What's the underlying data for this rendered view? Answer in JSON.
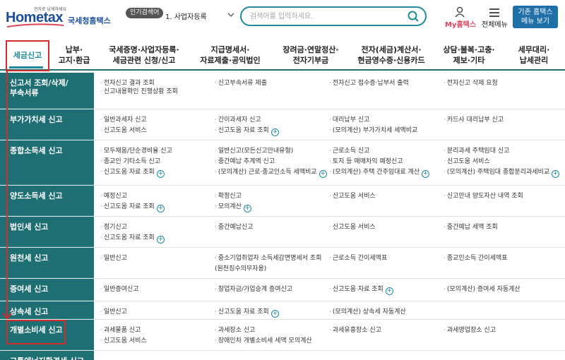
{
  "header": {
    "logo": {
      "tagline": "전자로 납세하세요",
      "brand": "Hometax",
      "org": "국세청홈택스"
    },
    "popular": {
      "badge": "인기검색어",
      "item": "1. 사업자등록"
    },
    "search": {
      "placeholder": "검색어를 입력하세요."
    },
    "my": "My홈택스",
    "menu": "전체메뉴",
    "classic": [
      "기존 홈택스",
      "메뉴 보기"
    ]
  },
  "nav": [
    {
      "lines": [
        "세금신고"
      ],
      "active": true
    },
    {
      "lines": [
        "납부·",
        "고지·환급"
      ]
    },
    {
      "lines": [
        "국세증명·사업자등록·",
        "세금관련 신청/신고"
      ]
    },
    {
      "lines": [
        "지급명세서·",
        "자료제출·공익법인"
      ]
    },
    {
      "lines": [
        "장려금·연말정산·",
        "전자기부금"
      ]
    },
    {
      "lines": [
        "전자(세금)계산서·",
        "현금영수증·신용카드"
      ]
    },
    {
      "lines": [
        "상담·불복·고충·",
        "제보·기타"
      ]
    },
    {
      "lines": [
        "세무대리·",
        "납세관리"
      ]
    }
  ],
  "rows": [
    {
      "head": [
        "신고서 조회/삭제/",
        "부속서류"
      ],
      "items": [
        [
          "전자신고 결과 조회",
          "신고부속서류 제출",
          "전자신고 접수증·납부서 출력",
          "전자신고 삭제 요청"
        ],
        [
          "신고내용확인 진행상황 조회",
          "",
          "",
          ""
        ]
      ]
    },
    {
      "head": [
        "부가가치세 신고"
      ],
      "items": [
        [
          "일반과세자 신고",
          "간이과세자 신고",
          "대리납부 신고",
          "카드사 대리납부 신고"
        ],
        [
          "신고도움 서비스",
          "신고도움 자료 조회",
          "(모의계산) 부가가치세 세액비교",
          ""
        ]
      ]
    },
    {
      "head": [
        "종합소득세 신고"
      ],
      "items": [
        [
          "모두채움/단순경비율 신고",
          "일반신고(모든신고안내유형)",
          "근로소득 신고",
          "분리과세 주택임대 신고"
        ],
        [
          "종교인 기타소득 신고",
          "중간예납 추계액 신고",
          "토지 등 매매차익 예정신고",
          "신고도움 서비스"
        ],
        [
          "신고도움 자료 조회",
          "(모의계산) 근로·종교인소득 세액비교",
          "(모의계산) 주택 간주임대료 계산",
          "(모의계산) 주택임대 종합분리과세비교"
        ]
      ]
    },
    {
      "head": [
        "양도소득세 신고"
      ],
      "items": [
        [
          "예정신고",
          "확정신고",
          "신고도움 서비스",
          "신고안내 양도자산 내역 조회"
        ],
        [
          "신고도움 자료 조회",
          "모의계산",
          "",
          ""
        ]
      ]
    },
    {
      "head": [
        "법인세 신고"
      ],
      "items": [
        [
          "정기신고",
          "중간예납신고",
          "신고도움 서비스",
          "중간예납 세액 조회"
        ],
        [
          "신고도움 자료 조회",
          "",
          "",
          ""
        ]
      ]
    },
    {
      "head": [
        "원천세 신고"
      ],
      "items": [
        [
          "일반신고",
          "중소기업취업자 소득세감면명세서 조회",
          "근로소득 간이세액표",
          "종교인소득 간이세액표"
        ],
        [
          "",
          "(원천징수의무자용)",
          "",
          ""
        ]
      ]
    },
    {
      "head": [
        "증여세 신고"
      ],
      "items": [
        [
          "일반증여신고",
          "창업자금/가업승계 증여신고",
          "신고도움 자료 조회",
          "(모의계산) 증여세 자동계산"
        ]
      ]
    },
    {
      "head": [
        "상속세 신고"
      ],
      "items": [
        [
          "일반신고",
          "신고도움 자료 조회",
          "(모의계산) 상속세 자동계산",
          ""
        ]
      ]
    },
    {
      "head": [
        "개별소비세 신고"
      ],
      "items": [
        [
          "과세물품 신고",
          "과세장소 신고",
          "과세유흥장소 신고",
          "과세영업장소 신고"
        ],
        [
          "신고도움 서비스",
          "장애인차 개별소비세 세액 모의계산",
          "",
          ""
        ]
      ]
    },
    {
      "head": [
        "교통에너지환경세 신고"
      ],
      "items": [
        [
          "",
          "",
          "",
          ""
        ]
      ]
    }
  ]
}
